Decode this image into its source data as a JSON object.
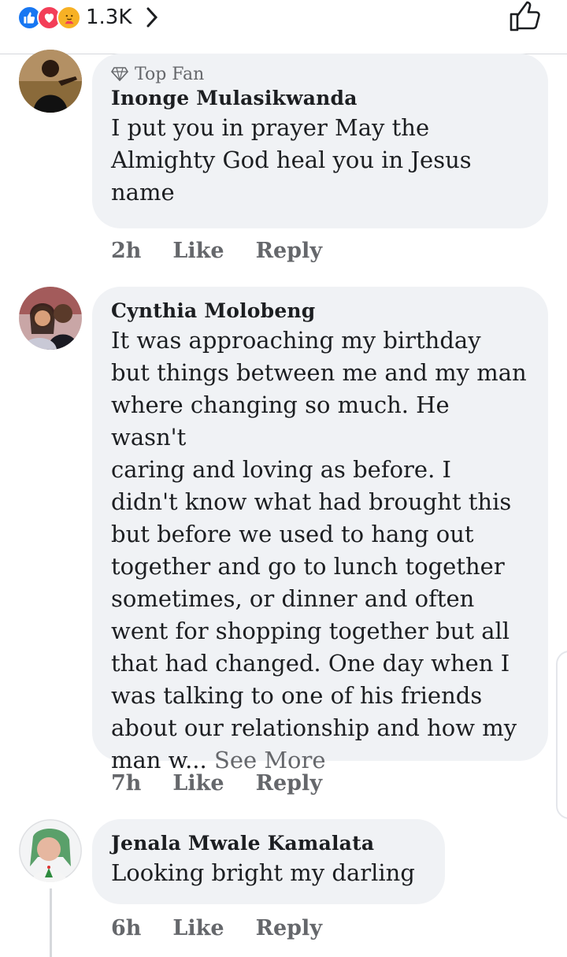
{
  "reactions": {
    "count": "1.3K",
    "types": [
      "like-icon",
      "love-icon",
      "care-icon"
    ],
    "colors": {
      "like": "#1877f2",
      "love": "#f33e58",
      "care": "#f7b125"
    }
  },
  "comments": [
    {
      "badge": "Top Fan",
      "name": "Inonge Mulasikwanda",
      "lines": [
        "I put you in prayer May the",
        "Almighty God heal you in Jesus",
        "name"
      ],
      "time": "2h",
      "like": "Like",
      "reply": "Reply"
    },
    {
      "name": "Cynthia Molobeng",
      "lines": [
        "It was approaching my birthday",
        "but things between me and my man",
        "where changing so much. He wasn't",
        "caring and loving as before. I",
        "didn't know what had brought this",
        "but before we used to hang out",
        "together and go to lunch together",
        "sometimes, or dinner and often",
        "went for shopping together but all",
        "that had changed. One day when I",
        "was talking to one of his friends",
        "about our relationship and how my",
        "man w..."
      ],
      "see_more": "See More",
      "time": "7h",
      "like": "Like",
      "reply": "Reply"
    },
    {
      "name": "Jenala Mwale Kamalata",
      "lines": [
        "Looking bright my darling"
      ],
      "time": "6h",
      "like": "Like",
      "reply": "Reply"
    }
  ]
}
